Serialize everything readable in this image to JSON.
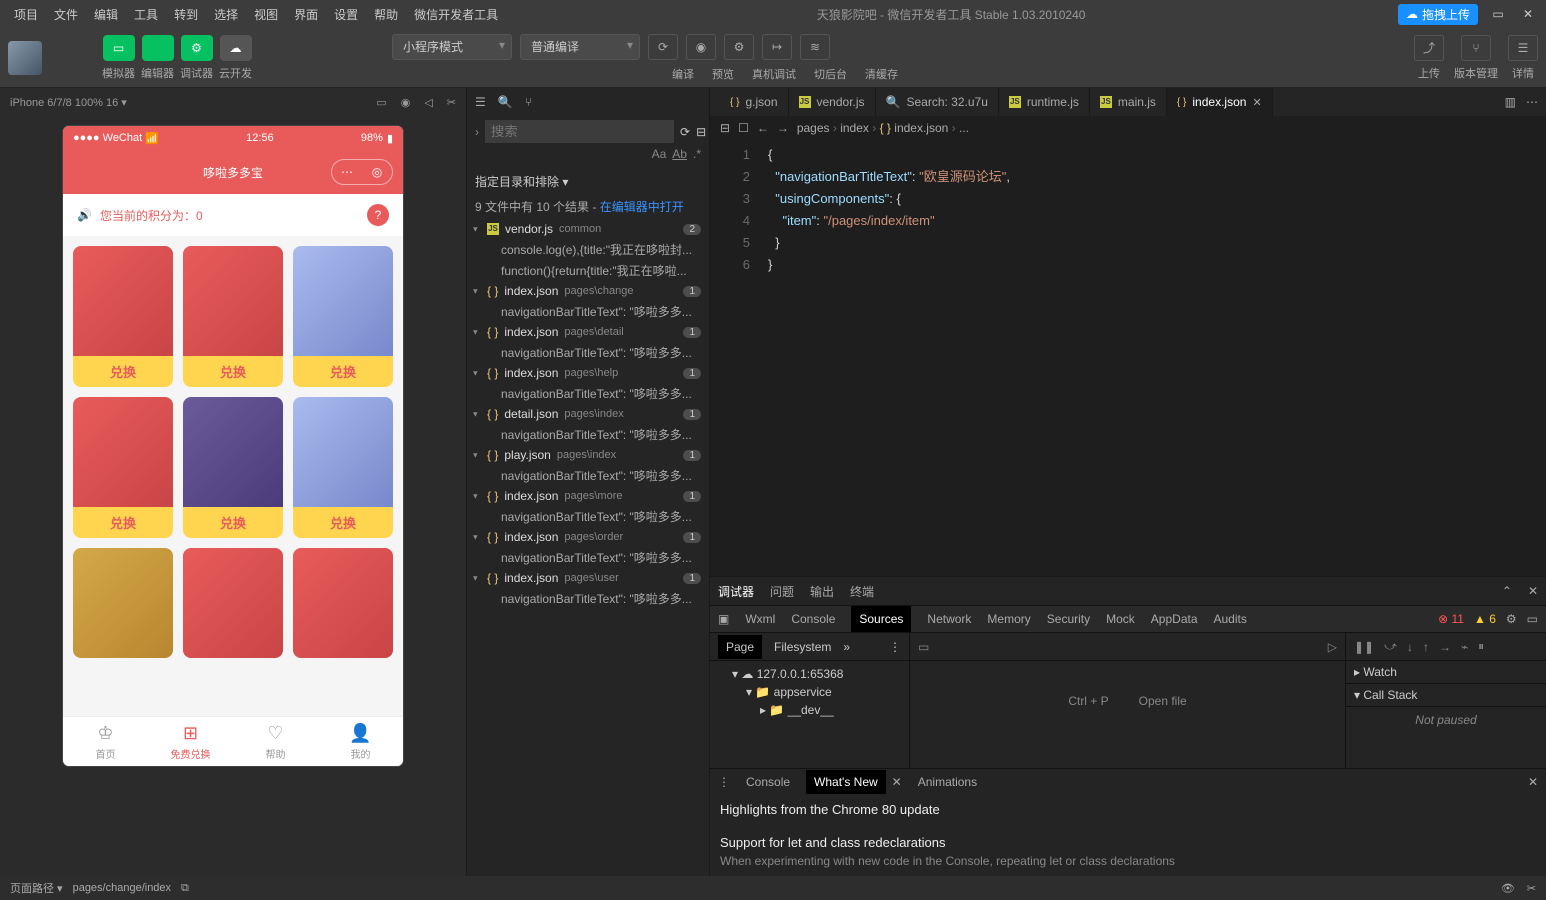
{
  "titlebar": {
    "menus": [
      "项目",
      "文件",
      "编辑",
      "工具",
      "转到",
      "选择",
      "视图",
      "界面",
      "设置",
      "帮助",
      "微信开发者工具"
    ],
    "title": "天狼影院吧 - 微信开发者工具 Stable 1.03.2010240",
    "upload": "拖拽上传"
  },
  "toolbar": {
    "cols": [
      {
        "label": "模拟器"
      },
      {
        "label": "编辑器"
      },
      {
        "label": "调试器"
      },
      {
        "label": "云开发"
      }
    ],
    "mode": "小程序模式",
    "compile": "普通编译",
    "acts": [
      "编译",
      "预览",
      "真机调试",
      "切后台",
      "清缓存"
    ],
    "right": [
      "上传",
      "版本管理",
      "详情"
    ]
  },
  "sim": {
    "device": "iPhone 6/7/8 100% 16 ▾",
    "status": {
      "left": "●●●● WeChat",
      "wifi": "⌵",
      "time": "12:56",
      "batt": "98%"
    },
    "nav": "哆啦多多宝",
    "points": "您当前的积分为：0",
    "exchange": "兑换",
    "tabs": [
      {
        "label": "首页"
      },
      {
        "label": "免费兑换"
      },
      {
        "label": "帮助"
      },
      {
        "label": "我的"
      }
    ]
  },
  "search": {
    "placeholder": "搜索",
    "filterLabel": "指定目录和排除 ▾",
    "summary": "9 文件中有 10 个结果 - ",
    "openLink": "在编辑器中打开",
    "results": [
      {
        "file": "vendor.js",
        "path": "common",
        "count": "2",
        "lines": [
          "console.log(e),{title:\"我正在哆啦封...",
          "function(){return{title:\"我正在哆啦..."
        ]
      },
      {
        "file": "index.json",
        "path": "pages\\change",
        "count": "1",
        "lines": [
          "navigationBarTitleText\": \"哆啦多多..."
        ]
      },
      {
        "file": "index.json",
        "path": "pages\\detail",
        "count": "1",
        "lines": [
          "navigationBarTitleText\": \"哆啦多多..."
        ]
      },
      {
        "file": "index.json",
        "path": "pages\\help",
        "count": "1",
        "lines": [
          "navigationBarTitleText\": \"哆啦多多..."
        ]
      },
      {
        "file": "detail.json",
        "path": "pages\\index",
        "count": "1",
        "lines": [
          "navigationBarTitleText\": \"哆啦多多..."
        ]
      },
      {
        "file": "play.json",
        "path": "pages\\index",
        "count": "1",
        "lines": [
          "navigationBarTitleText\": \"哆啦多多..."
        ]
      },
      {
        "file": "index.json",
        "path": "pages\\more",
        "count": "1",
        "lines": [
          "navigationBarTitleText\": \"哆啦多多..."
        ]
      },
      {
        "file": "index.json",
        "path": "pages\\order",
        "count": "1",
        "lines": [
          "navigationBarTitleText\": \"哆啦多多..."
        ]
      },
      {
        "file": "index.json",
        "path": "pages\\user",
        "count": "1",
        "lines": [
          "navigationBarTitleText\": \"哆啦多多..."
        ]
      }
    ]
  },
  "editor": {
    "tabs": [
      {
        "label": "g.json",
        "icon": "json"
      },
      {
        "label": "vendor.js",
        "icon": "js"
      },
      {
        "label": "Search: 32.u7u",
        "icon": "search"
      },
      {
        "label": "runtime.js",
        "icon": "js"
      },
      {
        "label": "main.js",
        "icon": "js"
      },
      {
        "label": "index.json",
        "icon": "json",
        "active": true
      }
    ],
    "crumb": [
      "pages",
      "index",
      "index.json",
      "..."
    ],
    "code": {
      "k1": "\"navigationBarTitleText\"",
      "v1": "\"欧皇源码论坛\"",
      "k2": "\"usingComponents\"",
      "k3": "\"item\"",
      "v3": "\"/pages/index/item\""
    }
  },
  "dev": {
    "topTabs": [
      "调试器",
      "问题",
      "输出",
      "终端"
    ],
    "dtTabs": [
      "Wxml",
      "Console",
      "Sources",
      "Network",
      "Memory",
      "Security",
      "Mock",
      "AppData",
      "Audits"
    ],
    "err": "11",
    "warn": "6",
    "srcTabs": [
      "Page",
      "Filesystem"
    ],
    "tree": {
      "host": "127.0.0.1:65368",
      "app": "appservice",
      "dev": "__dev__"
    },
    "openCmd": "Ctrl + P",
    "openFile": "Open file",
    "watch": "Watch",
    "callstack": "Call Stack",
    "notpaused": "Not paused",
    "footTabs": [
      "Console",
      "What's New",
      "Animations"
    ],
    "highTitle": "Highlights from the Chrome 80 update",
    "letTitle": "Support for let and class redeclarations",
    "letDesc": "When experimenting with new code in the Console, repeating let or class declarations"
  },
  "status": {
    "path": "页面路径 ▾",
    "pathVal": "pages/change/index"
  }
}
